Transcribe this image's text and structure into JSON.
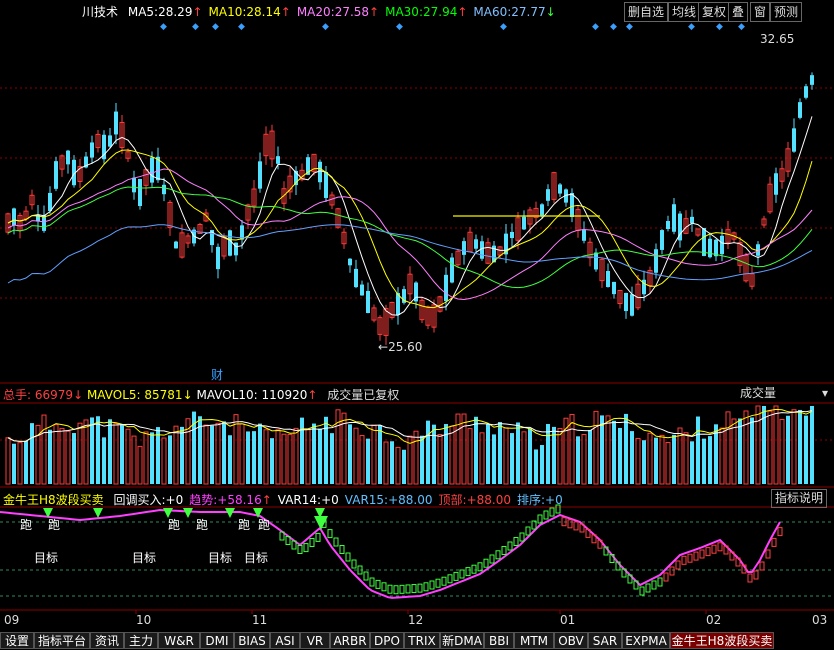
{
  "header": {
    "stock_name": "川技术",
    "ma": [
      {
        "label": "MA5:",
        "value": "28.29",
        "arrow": "↑",
        "color": "#ffffff"
      },
      {
        "label": "MA10:",
        "value": "28.14",
        "arrow": "↑",
        "color": "#ffff00"
      },
      {
        "label": "MA20:",
        "value": "27.58",
        "arrow": "↑",
        "color": "#ff80ff"
      },
      {
        "label": "MA30:",
        "value": "27.94",
        "arrow": "↑",
        "color": "#00ff00"
      },
      {
        "label": "MA60:",
        "value": "27.77",
        "arrow": "↓",
        "color": "#80c0ff"
      }
    ],
    "buttons": [
      "删自选",
      "均线",
      "复权",
      "叠",
      "窗",
      "预测"
    ]
  },
  "price_panel": {
    "high_label": "32.65",
    "low_label": "25.60",
    "event_marker": "财"
  },
  "volume_panel": {
    "total_label": "总手:",
    "total_value": "66979",
    "total_arrow": "↓",
    "mavol5_label": "MAVOL5:",
    "mavol5_value": "85781",
    "mavol5_arrow": "↓",
    "mavol10_label": "MAVOL10:",
    "mavol10_value": "110920",
    "mavol10_arrow": "↑",
    "note": "成交量已复权",
    "dropdown": "成交量"
  },
  "indicator_panel": {
    "name": "金牛王H8波段买卖",
    "items": [
      {
        "label": "回调买入:",
        "value": "+0",
        "color": "#ffffff"
      },
      {
        "label": "趋势:",
        "value": "+58.16",
        "arrow": "↑",
        "color": "#ff40ff"
      },
      {
        "label": "VAR14:",
        "value": "+0",
        "color": "#ffffff"
      },
      {
        "label": "VAR15:",
        "value": "+88.00",
        "color": "#60c0ff"
      },
      {
        "label": "顶部:",
        "value": "+88.00",
        "color": "#ff4040"
      },
      {
        "label": "排序:",
        "value": "+0",
        "color": "#60c0ff"
      }
    ],
    "help_button": "指标说明",
    "run_labels": [
      "跑",
      "跑",
      "跑",
      "跑",
      "跑",
      "跑"
    ],
    "target_labels": [
      "目标",
      "目标",
      "目标",
      "目标"
    ]
  },
  "x_axis": [
    "09",
    "10",
    "11",
    "12",
    "01",
    "02",
    "03"
  ],
  "tabs": [
    "设置",
    "指标平台",
    "资讯",
    "主力",
    "W&R",
    "DMI",
    "BIAS",
    "ASI",
    "VR",
    "ARBR",
    "DPO",
    "TRIX",
    "新DMA",
    "BBI",
    "MTM",
    "OBV",
    "SAR",
    "EXPMA",
    "金牛王H8波段买卖"
  ],
  "colors": {
    "up": "#ff3b3b",
    "down": "#54e0ff",
    "grid": "#8b0000"
  }
}
